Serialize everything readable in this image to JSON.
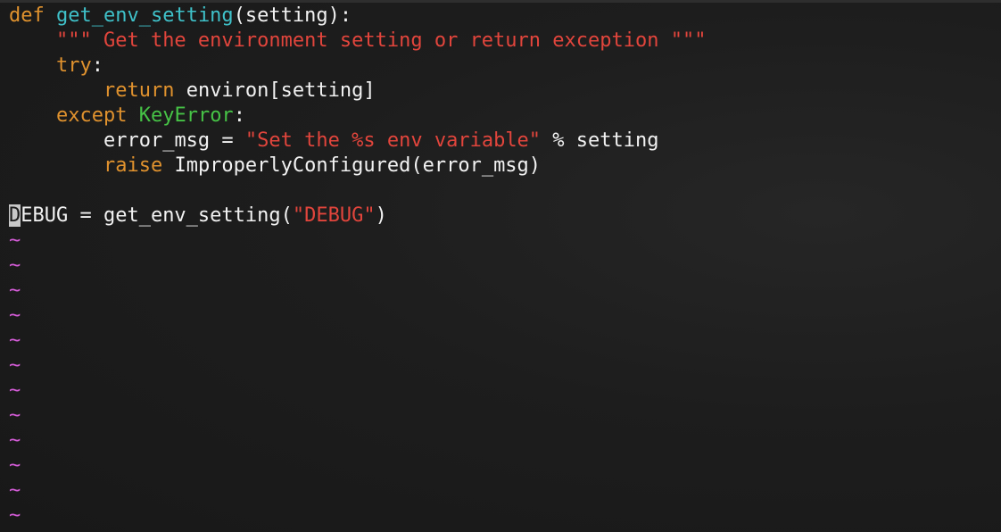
{
  "editor": {
    "lines": {
      "l1": {
        "kw": "def",
        "sp": " ",
        "fn": "get_env_setting",
        "rest": "(setting):"
      },
      "l2": {
        "indent": "    ",
        "doc": "\"\"\" Get the environment setting or return exception \"\"\""
      },
      "l3": {
        "indent": "    ",
        "kw": "try",
        "rest": ":"
      },
      "l4": {
        "indent": "        ",
        "kw": "return",
        "rest": " environ[setting]"
      },
      "l5": {
        "indent": "    ",
        "kw": "except",
        "sp": " ",
        "exc": "KeyError",
        "rest": ":"
      },
      "l6": {
        "indent": "        ",
        "lhs": "error_msg = ",
        "str": "\"Set the %s env variable\"",
        "rest": " % setting"
      },
      "l7": {
        "indent": "        ",
        "kw": "raise",
        "rest": " ImproperlyConfigured(error_msg)"
      },
      "l9": {
        "cursor_char": "D",
        "lhs": "EBUG = get_env_setting(",
        "str": "\"DEBUG\"",
        "rest": ")"
      }
    },
    "tilde": "~"
  },
  "colors": {
    "keyword": "#e0922e",
    "function": "#3fc1c9",
    "string": "#e2453c",
    "exception": "#46c346",
    "text": "#f2f2f2",
    "tilde": "#d35bd6",
    "background": "#1b1b1b"
  }
}
